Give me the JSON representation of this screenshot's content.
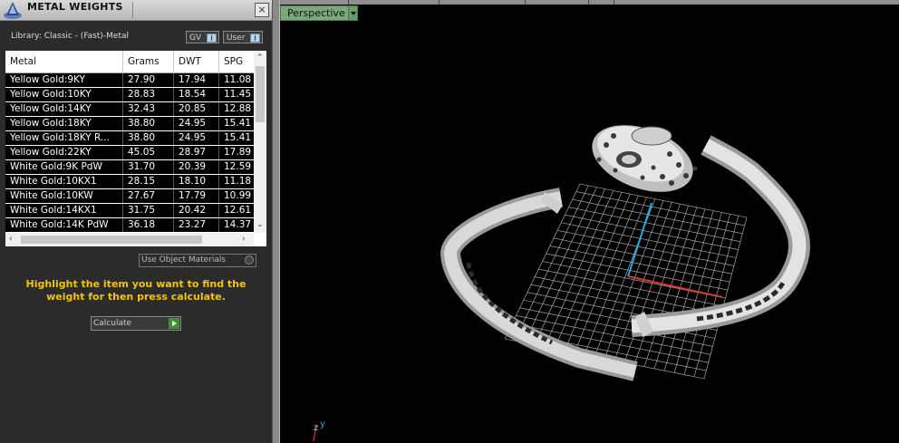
{
  "panel": {
    "title": "METAL WEIGHTS",
    "close_label": "×",
    "library": "Library: Classic - (Fast)-Metal",
    "toggle_gv": "GV",
    "toggle_user": "User",
    "table": {
      "columns": [
        "Metal",
        "Grams",
        "DWT",
        "SPG"
      ],
      "rows": [
        [
          "Yellow Gold:9KY",
          "27.90",
          "17.94",
          "11.08"
        ],
        [
          "Yellow Gold:10KY",
          "28.83",
          "18.54",
          "11.45"
        ],
        [
          "Yellow Gold:14KY",
          "32.43",
          "20.85",
          "12.88"
        ],
        [
          "Yellow Gold:18KY",
          "38.80",
          "24.95",
          "15.41"
        ],
        [
          "Yellow Gold:18KY R...",
          "38.80",
          "24.95",
          "15.41"
        ],
        [
          "Yellow Gold:22KY",
          "45.05",
          "28.97",
          "17.89"
        ],
        [
          "White Gold:9K PdW",
          "31.70",
          "20.39",
          "12.59"
        ],
        [
          "White Gold:10KX1",
          "28.15",
          "18.10",
          "11.18"
        ],
        [
          "White Gold:10KW",
          "27.67",
          "17.79",
          "10.99"
        ],
        [
          "White Gold:14KX1",
          "31.75",
          "20.42",
          "12.61"
        ],
        [
          "White Gold:14K PdW",
          "36.18",
          "23.27",
          "14.37"
        ]
      ]
    },
    "use_object_materials": "Use Object Materials",
    "hint": "Highlight the item you want to find the weight for then press calculate.",
    "calculate_label": "Calculate"
  },
  "viewport": {
    "view_label": "Perspective",
    "axis_labels": {
      "z": "z",
      "y": "y"
    },
    "axis_colors": {
      "y": "#2aa8d8",
      "x": "#d83a2a"
    }
  }
}
